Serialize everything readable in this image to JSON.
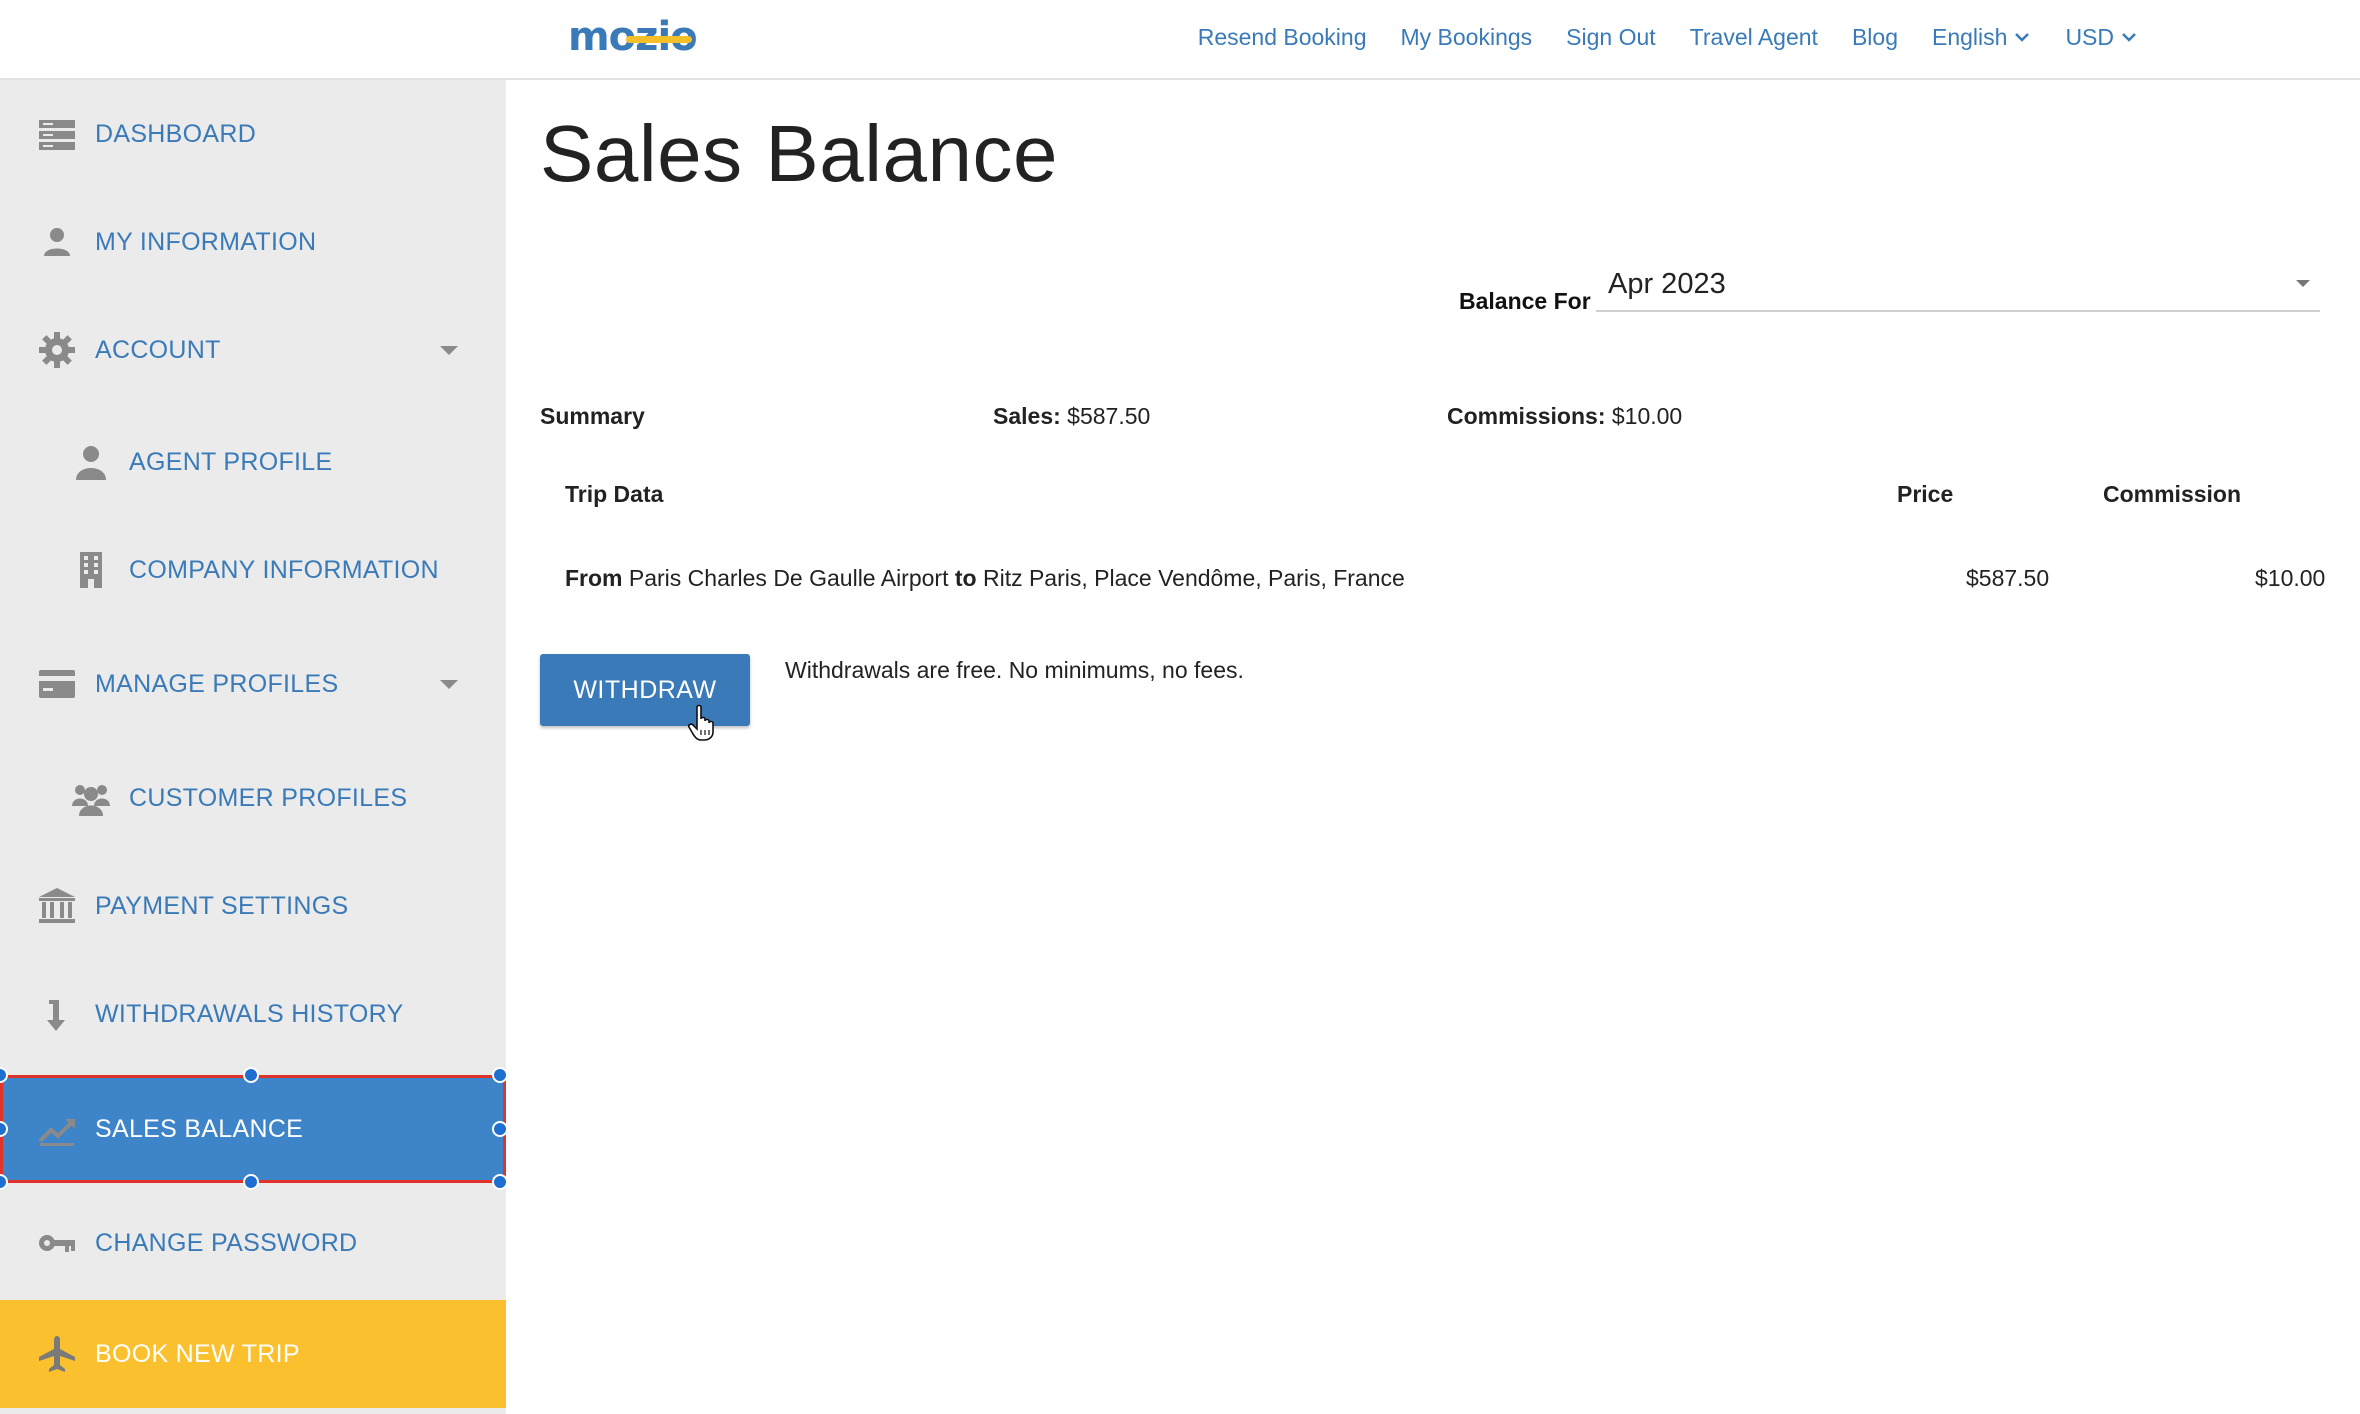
{
  "header": {
    "logo_text": "mozio",
    "nav": [
      {
        "label": "Resend Booking"
      },
      {
        "label": "My Bookings"
      },
      {
        "label": "Sign Out"
      },
      {
        "label": "Travel Agent"
      },
      {
        "label": "Blog"
      },
      {
        "label": "English"
      },
      {
        "label": "USD"
      }
    ]
  },
  "sidebar": {
    "items": [
      {
        "label": "DASHBOARD",
        "icon": "dashboard-icon"
      },
      {
        "label": "MY INFORMATION",
        "icon": "user-icon"
      },
      {
        "label": "ACCOUNT",
        "icon": "gear-icon"
      },
      {
        "label": "AGENT PROFILE",
        "icon": "user-icon"
      },
      {
        "label": "COMPANY INFORMATION",
        "icon": "building-icon"
      },
      {
        "label": "MANAGE PROFILES",
        "icon": "card-icon"
      },
      {
        "label": "CUSTOMER PROFILES",
        "icon": "users-icon"
      },
      {
        "label": "PAYMENT SETTINGS",
        "icon": "bank-icon"
      },
      {
        "label": "WITHDRAWALS HISTORY",
        "icon": "arrow-down-icon"
      },
      {
        "label": "SALES BALANCE",
        "icon": "chart-icon"
      },
      {
        "label": "CHANGE PASSWORD",
        "icon": "key-icon"
      },
      {
        "label": "BOOK NEW TRIP",
        "icon": "plane-icon"
      }
    ],
    "active": "SALES BALANCE"
  },
  "main": {
    "title": "Sales Balance",
    "balance_for_label": "Balance For",
    "balance_for_value": "Apr 2023",
    "summary": {
      "label": "Summary",
      "sales_label": "Sales:",
      "sales_value": "$587.50",
      "commissions_label": "Commissions:",
      "commissions_value": "$10.00"
    },
    "table": {
      "headers": [
        "Trip Data",
        "Price",
        "Commission"
      ],
      "rows": [
        {
          "from_label": "From",
          "from": "Paris Charles De Gaulle Airport",
          "to_label": "to",
          "to": "Ritz Paris, Place Vendôme, Paris, France",
          "price": "$587.50",
          "commission": "$10.00"
        }
      ]
    },
    "withdraw_label": "WITHDRAW",
    "withdraw_note": "Withdrawals are free. No minimums, no fees."
  },
  "colors": {
    "brand_blue": "#3a7ab8",
    "active_bg": "#3d85c8",
    "book_bg": "#fbc02d",
    "sidebar_bg": "#ebebeb"
  }
}
